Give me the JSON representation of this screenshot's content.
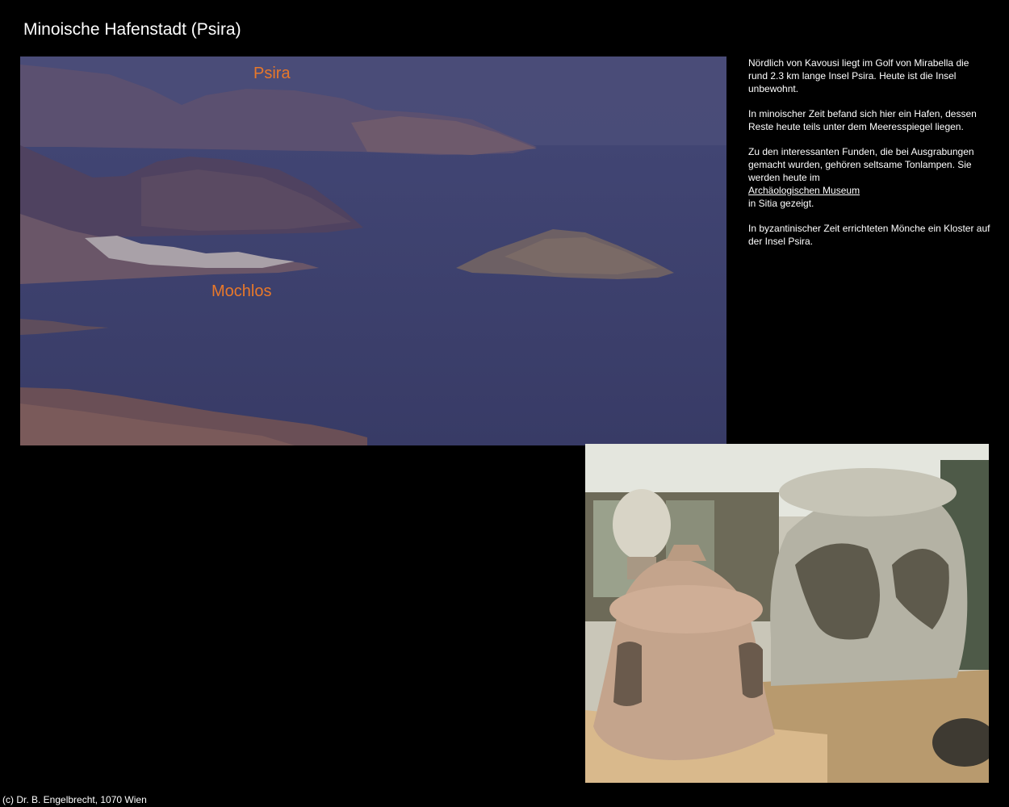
{
  "page": {
    "title": "Minoische Hafenstadt (Psira)"
  },
  "landscape": {
    "label_psira": "Psira",
    "label_mochlos": "Mochlos"
  },
  "text": {
    "p1": "Nördlich von Kavousi liegt im Golf von Mirabella die rund 2.3 km lange Insel Psira. Heute ist die Insel unbewohnt.",
    "p2": "In minoischer Zeit befand sich hier ein Hafen, dessen Reste heute teils unter dem Meeresspiegel liegen.",
    "p3_intro": "Zu den interessanten Funden, die bei Ausgrabungen gemacht wurden, gehören seltsame Tonlampen. Sie werden heute im",
    "p3_link": "Archäologischen Museum",
    "p3_outro": "in Sitia gezeigt.",
    "p4": "In byzantinischer Zeit errichteten Mönche ein Kloster auf der Insel Psira."
  },
  "footer": {
    "copyright": "(c) Dr. B. Engelbrecht, 1070 Wien"
  },
  "colors": {
    "background": "#000000",
    "label": "#e8782a",
    "sea": "#3d4170"
  }
}
